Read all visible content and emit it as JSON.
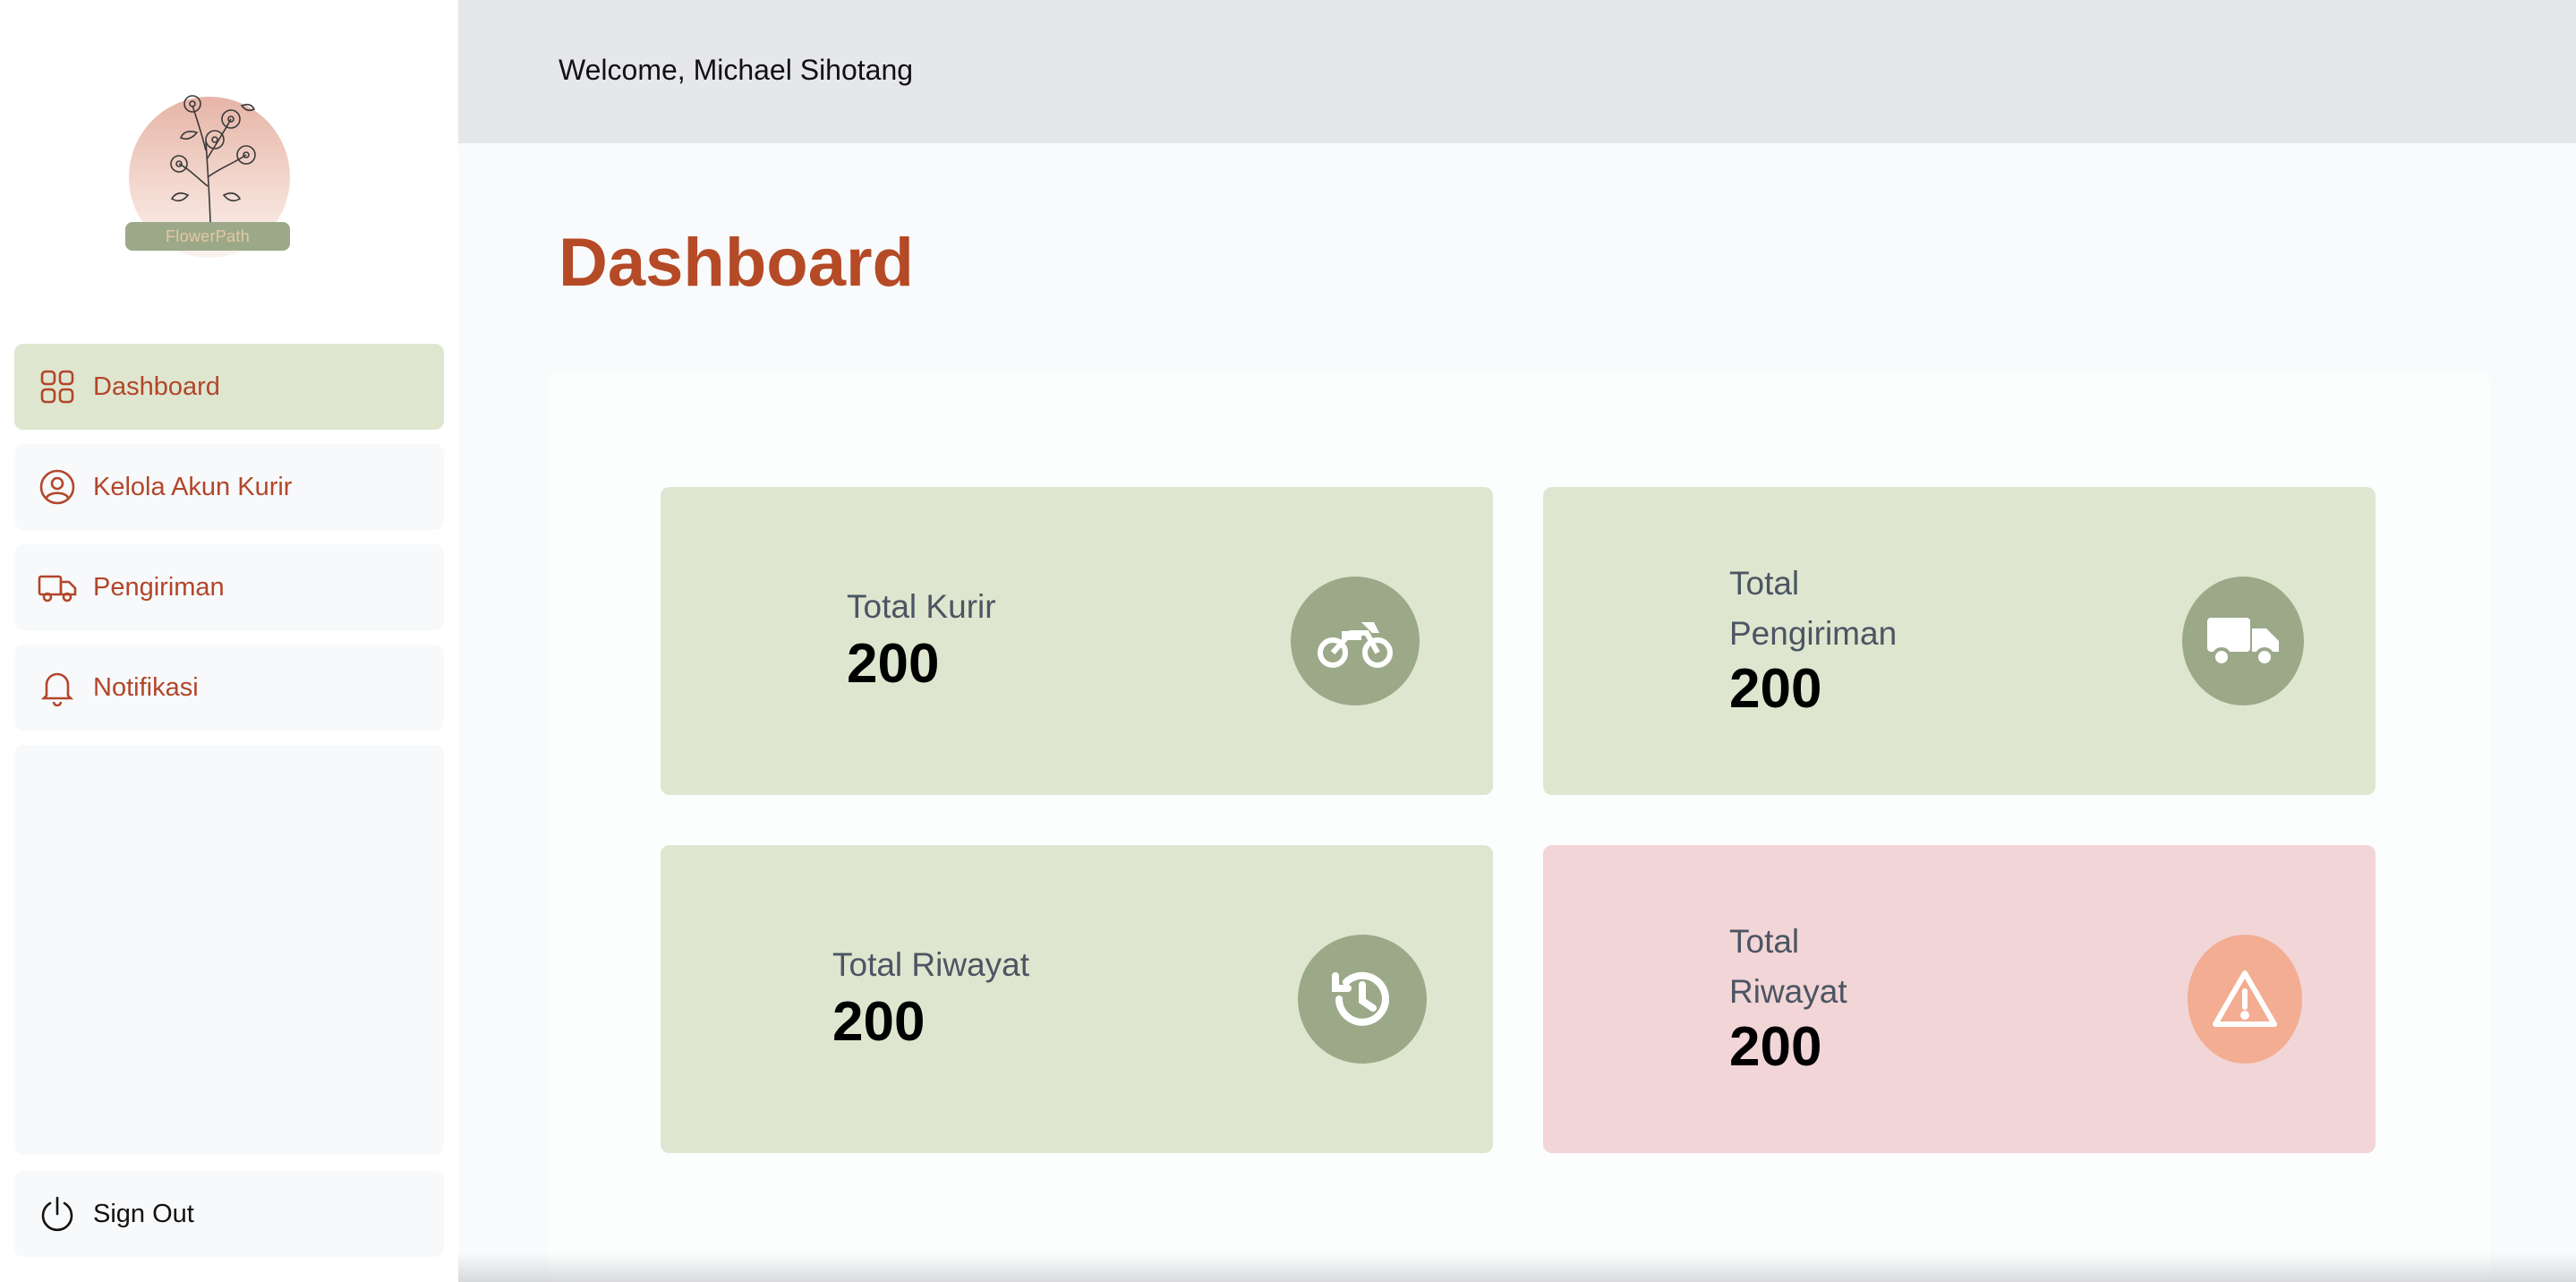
{
  "brand": {
    "name": "FlowerPath"
  },
  "header": {
    "welcome": "Welcome, Michael Sihotang"
  },
  "page": {
    "title": "Dashboard"
  },
  "sidebar": {
    "items": [
      {
        "label": "Dashboard",
        "icon": "grid-icon",
        "active": true
      },
      {
        "label": "Kelola Akun Kurir",
        "icon": "user-circle-icon",
        "active": false
      },
      {
        "label": "Pengiriman",
        "icon": "truck-icon",
        "active": false
      },
      {
        "label": "Notifikasi",
        "icon": "bell-icon",
        "active": false
      }
    ],
    "signout": {
      "label": "Sign Out",
      "icon": "power-icon"
    }
  },
  "cards": [
    {
      "label": "Total Kurir",
      "value": "200",
      "icon": "motorcycle-icon"
    },
    {
      "label_line1": "Total",
      "label_line2": "Pengiriman",
      "value": "200",
      "icon": "truck-icon"
    },
    {
      "label": "Total Riwayat",
      "value": "200",
      "icon": "history-icon"
    },
    {
      "label_line1": "Total",
      "label_line2": "Riwayat",
      "value": "200",
      "icon": "warning-icon"
    }
  ],
  "colors": {
    "accent": "#b54a26",
    "card_green": "#dfe6cf",
    "card_pink": "#f2d5d6",
    "icon_green": "#9ba989",
    "icon_peach": "#f2ad92"
  }
}
